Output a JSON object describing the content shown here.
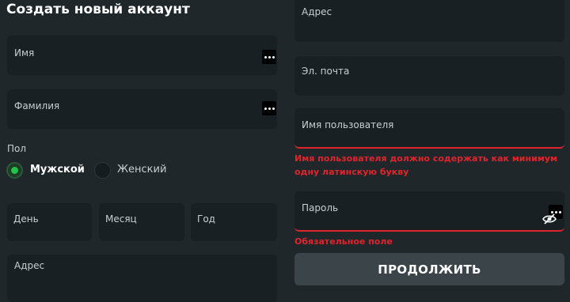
{
  "form": {
    "title": "Создать новый аккаунт",
    "first_name_label": "Имя",
    "last_name_label": "Фамилия",
    "gender": {
      "label": "Пол",
      "options": [
        "Мужской",
        "Женский"
      ],
      "selected": "Мужской"
    },
    "birth": {
      "day_label": "День",
      "month_label": "Месяц",
      "year_label": "Год"
    },
    "address_label": "Адрес",
    "address_top_label": "Адрес",
    "email_label": "Эл. почта",
    "username_label": "Имя пользователя",
    "username_error": "Имя пользователя должно содержать как минимум одну латинскую букву",
    "password_label": "Пароль",
    "password_error": "Обязательное поле",
    "continue_label": "ПРОДОЛЖИТЬ"
  },
  "colors": {
    "background": "#1f272b",
    "field": "#182024",
    "error": "#e0242c",
    "radio_selected": "#22c348",
    "button": "#3a4449"
  },
  "icons": [
    "password-manager-icon",
    "eye-slash-icon"
  ]
}
